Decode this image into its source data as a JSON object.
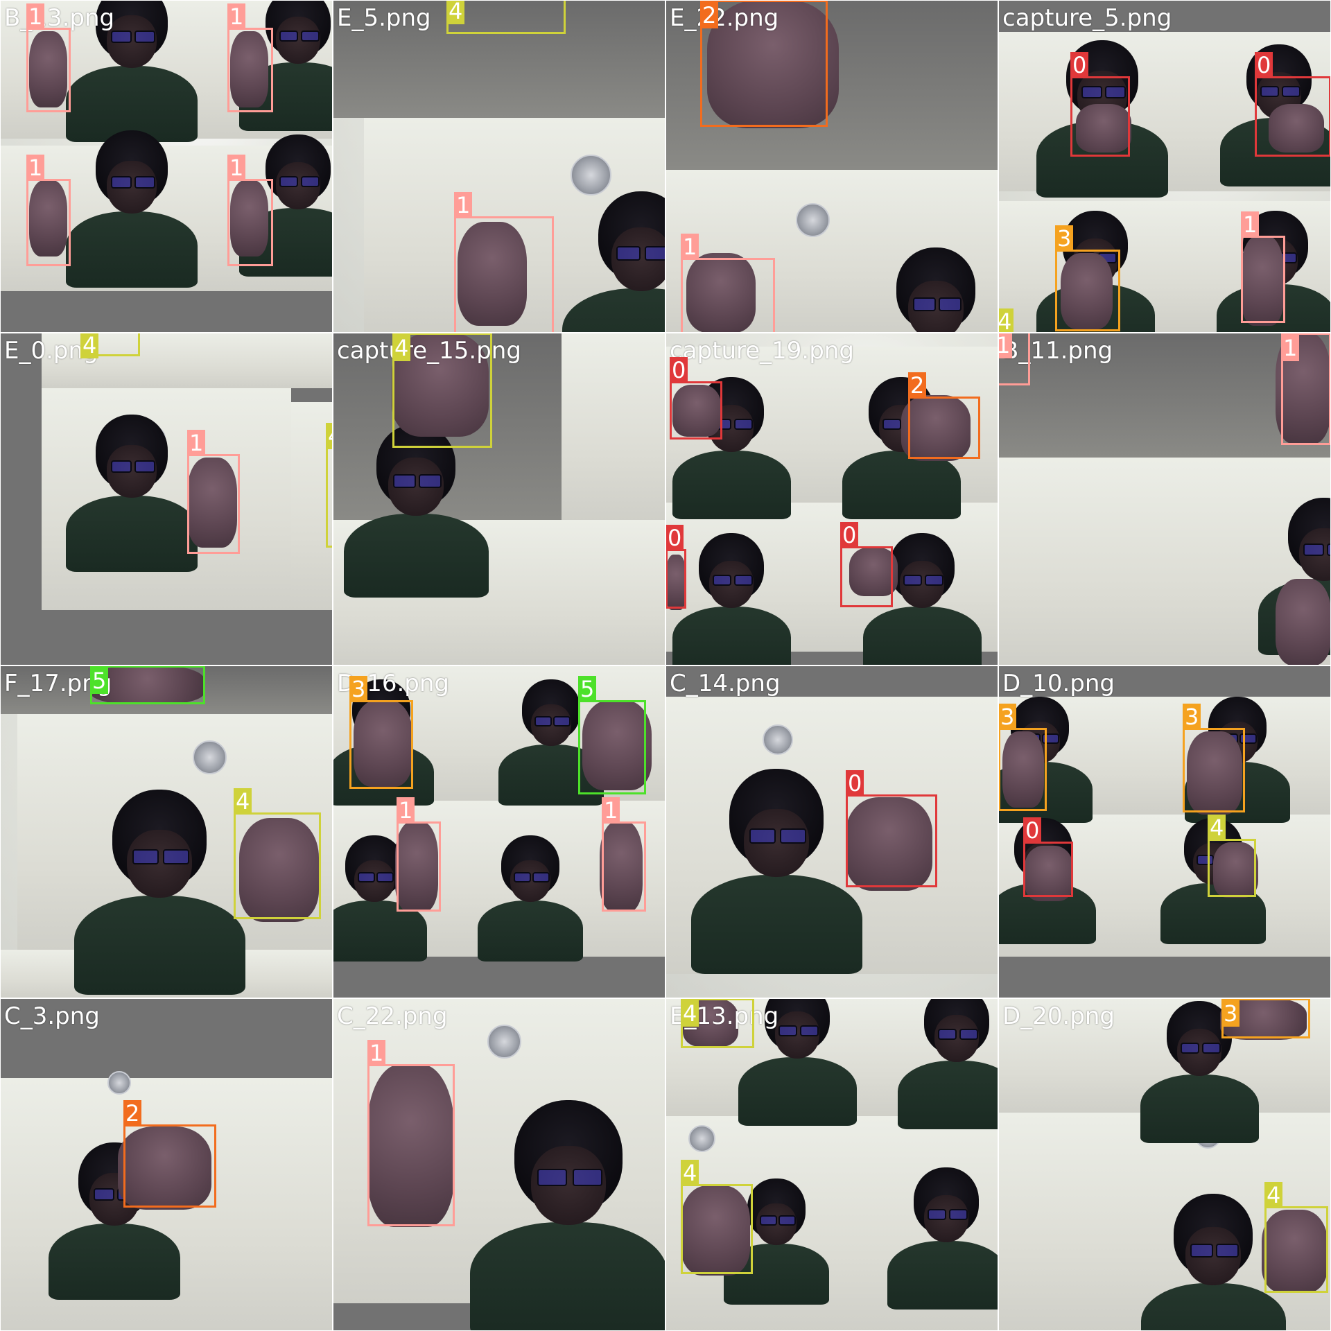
{
  "colors": {
    "class_0": "#e0383a",
    "class_1": "#ff9d97",
    "class_2": "#f26c1e",
    "class_3": "#f5a21f",
    "class_4": "#cfd23a",
    "class_5": "#4de12a",
    "pad": "#727272"
  },
  "tiles": [
    {
      "name": "B_13.png",
      "label": "B_13.png"
    },
    {
      "name": "E_5.png",
      "label": "E_5.png"
    },
    {
      "name": "E_22.png",
      "label": "E_22.png"
    },
    {
      "name": "capture_5.png",
      "label": "capture_5.png"
    },
    {
      "name": "E_0.png",
      "label": "E_0.png"
    },
    {
      "name": "capture_15.png",
      "label": "capture_15.png"
    },
    {
      "name": "capture_19.png",
      "label": "capture_19.png"
    },
    {
      "name": "B_11.png",
      "label": "B_11.png"
    },
    {
      "name": "F_17.png",
      "label": "F_17.png"
    },
    {
      "name": "D_16.png",
      "label": "D_16.png"
    },
    {
      "name": "C_14.png",
      "label": "C_14.png"
    },
    {
      "name": "D_10.png",
      "label": "D_10.png"
    },
    {
      "name": "C_3.png",
      "label": "C_3.png"
    },
    {
      "name": "C_22.png",
      "label": "C_22.png"
    },
    {
      "name": "E_13.png",
      "label": "E_13.png"
    },
    {
      "name": "D_20.png",
      "label": "D_20.png"
    }
  ],
  "detections": [
    {
      "tile": 0,
      "cls": "1"
    },
    {
      "tile": 0,
      "cls": "1"
    },
    {
      "tile": 0,
      "cls": "1"
    },
    {
      "tile": 0,
      "cls": "1"
    },
    {
      "tile": 1,
      "cls": "4"
    },
    {
      "tile": 1,
      "cls": "1"
    },
    {
      "tile": 2,
      "cls": "2"
    },
    {
      "tile": 2,
      "cls": "1"
    },
    {
      "tile": 3,
      "cls": "0"
    },
    {
      "tile": 3,
      "cls": "0"
    },
    {
      "tile": 3,
      "cls": "3"
    },
    {
      "tile": 3,
      "cls": "1"
    },
    {
      "tile": 3,
      "cls": "4"
    },
    {
      "tile": 4,
      "cls": "4"
    },
    {
      "tile": 4,
      "cls": "1"
    },
    {
      "tile": 4,
      "cls": "4"
    },
    {
      "tile": 5,
      "cls": "4"
    },
    {
      "tile": 6,
      "cls": "0"
    },
    {
      "tile": 6,
      "cls": "2"
    },
    {
      "tile": 6,
      "cls": "0"
    },
    {
      "tile": 6,
      "cls": "0"
    },
    {
      "tile": 7,
      "cls": "1"
    },
    {
      "tile": 7,
      "cls": "1"
    },
    {
      "tile": 8,
      "cls": "5"
    },
    {
      "tile": 8,
      "cls": "4"
    },
    {
      "tile": 9,
      "cls": "3"
    },
    {
      "tile": 9,
      "cls": "5"
    },
    {
      "tile": 9,
      "cls": "1"
    },
    {
      "tile": 9,
      "cls": "1"
    },
    {
      "tile": 10,
      "cls": "0"
    },
    {
      "tile": 11,
      "cls": "3"
    },
    {
      "tile": 11,
      "cls": "3"
    },
    {
      "tile": 11,
      "cls": "0"
    },
    {
      "tile": 11,
      "cls": "4"
    },
    {
      "tile": 12,
      "cls": "2"
    },
    {
      "tile": 13,
      "cls": "1"
    },
    {
      "tile": 14,
      "cls": "4"
    },
    {
      "tile": 14,
      "cls": "4"
    },
    {
      "tile": 15,
      "cls": "3"
    },
    {
      "tile": 15,
      "cls": "4"
    }
  ]
}
